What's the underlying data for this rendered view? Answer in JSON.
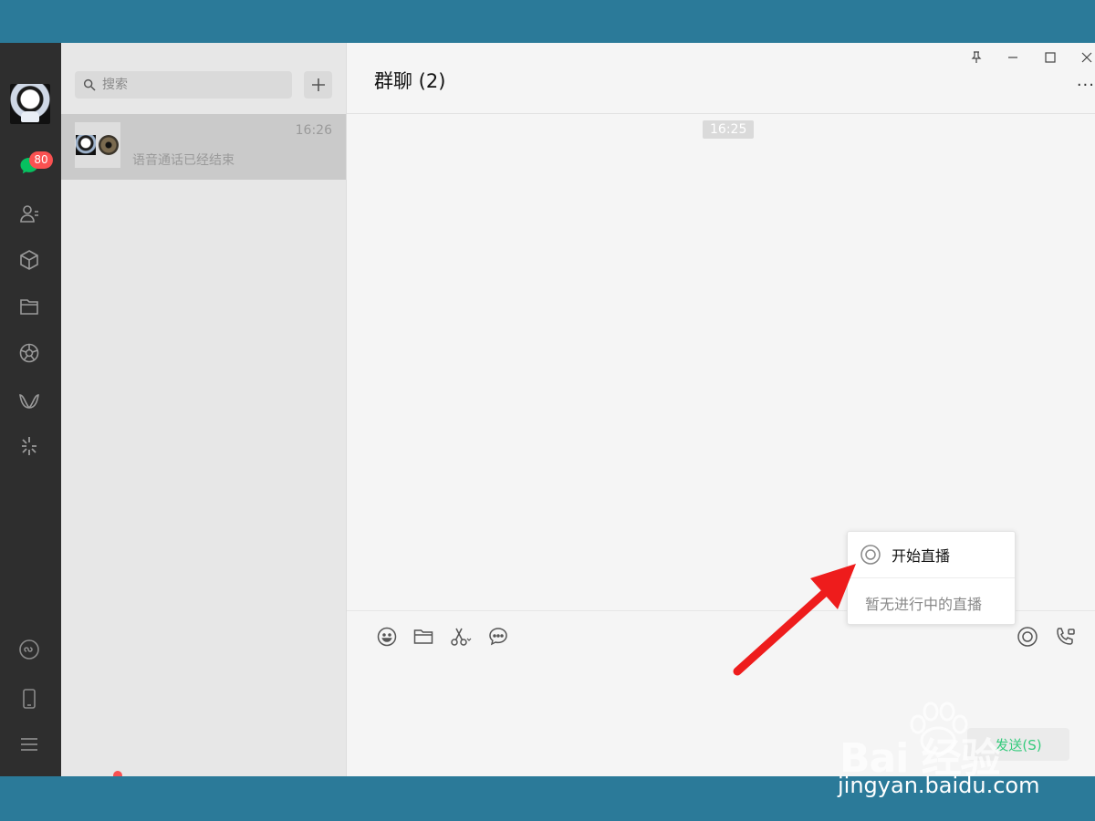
{
  "nav": {
    "unread_badge": "80",
    "icons": [
      "chat-icon",
      "contacts-icon",
      "favorites-icon",
      "files-icon",
      "moments-icon",
      "channels-icon",
      "search-discover-icon",
      "mini-programs-icon",
      "phone-icon",
      "menu-icon"
    ]
  },
  "chat_list": {
    "search_placeholder": "搜索",
    "items": [
      {
        "time": "16:26",
        "preview": "语音通话已经结束"
      }
    ]
  },
  "chat": {
    "title": "群聊 (2)",
    "more_label": "···",
    "timestamp": "16:25",
    "send_label": "发送(S)"
  },
  "popup": {
    "start_live": "开始直播",
    "no_live": "暂无进行中的直播"
  },
  "watermark": {
    "brand": "Bai  经验",
    "url": "jingyan.baidu.com"
  },
  "colors": {
    "accent_green": "#07c160",
    "badge_red": "#fa5151",
    "frame_blue": "#2b7a99",
    "nav_dark": "#2e2e2e"
  }
}
